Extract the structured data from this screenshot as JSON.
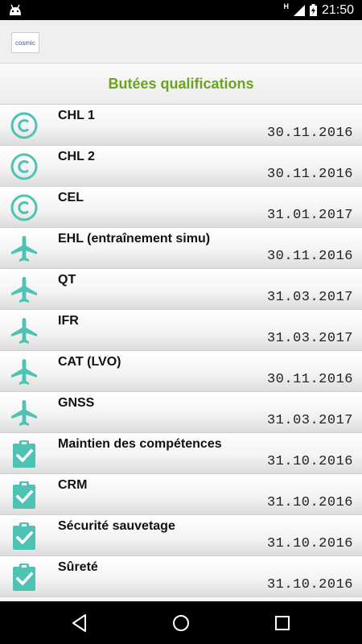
{
  "status_bar": {
    "time": "21:50",
    "network": "H"
  },
  "app_bar": {
    "logo_text": "cosmic"
  },
  "page": {
    "title": "Butées qualifications"
  },
  "colors": {
    "accent_green": "#6aa420",
    "icon_teal": "#4fc3b3"
  },
  "items": [
    {
      "icon": "copyright-icon",
      "label": "CHL 1",
      "date": "30.11.2016"
    },
    {
      "icon": "copyright-icon",
      "label": "CHL 2",
      "date": "30.11.2016"
    },
    {
      "icon": "copyright-icon",
      "label": "CEL",
      "date": "31.01.2017"
    },
    {
      "icon": "airplane-icon",
      "label": "EHL (entraînement simu)",
      "date": "30.11.2016"
    },
    {
      "icon": "airplane-icon",
      "label": "QT",
      "date": "31.03.2017"
    },
    {
      "icon": "airplane-icon",
      "label": "IFR",
      "date": "31.03.2017"
    },
    {
      "icon": "airplane-icon",
      "label": "CAT (LVO)",
      "date": "30.11.2016"
    },
    {
      "icon": "airplane-icon",
      "label": "GNSS",
      "date": "31.03.2017"
    },
    {
      "icon": "clipboard-check-icon",
      "label": "Maintien des compétences",
      "date": "31.10.2016"
    },
    {
      "icon": "clipboard-check-icon",
      "label": "CRM",
      "date": "31.10.2016"
    },
    {
      "icon": "clipboard-check-icon",
      "label": "Sécurité sauvetage",
      "date": "31.10.2016"
    },
    {
      "icon": "clipboard-check-icon",
      "label": "Sûreté",
      "date": "31.10.2016"
    }
  ]
}
